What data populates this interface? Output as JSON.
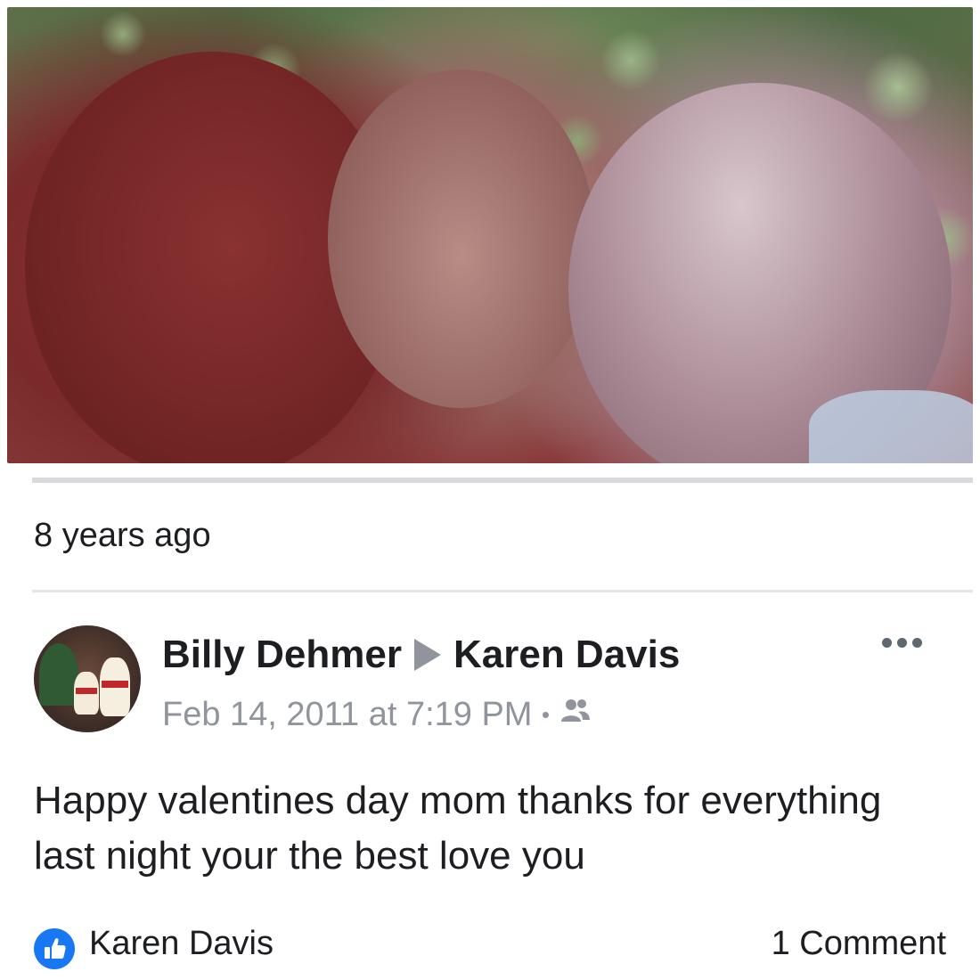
{
  "memory": {
    "time_ago": "8 years ago"
  },
  "post": {
    "author": "Billy Dehmer",
    "recipient": "Karen Davis",
    "timestamp": "Feb 14, 2011 at 7:19 PM",
    "audience_icon": "friends-icon",
    "text": "Happy valentines day mom thanks for everything last night your the best love you",
    "reactions": {
      "icon": "like-icon",
      "names": "Karen Davis"
    },
    "comments": "1 Comment"
  },
  "colors": {
    "like_blue": "#1877f2",
    "meta_gray": "#90949c",
    "text": "#1c1e21"
  }
}
